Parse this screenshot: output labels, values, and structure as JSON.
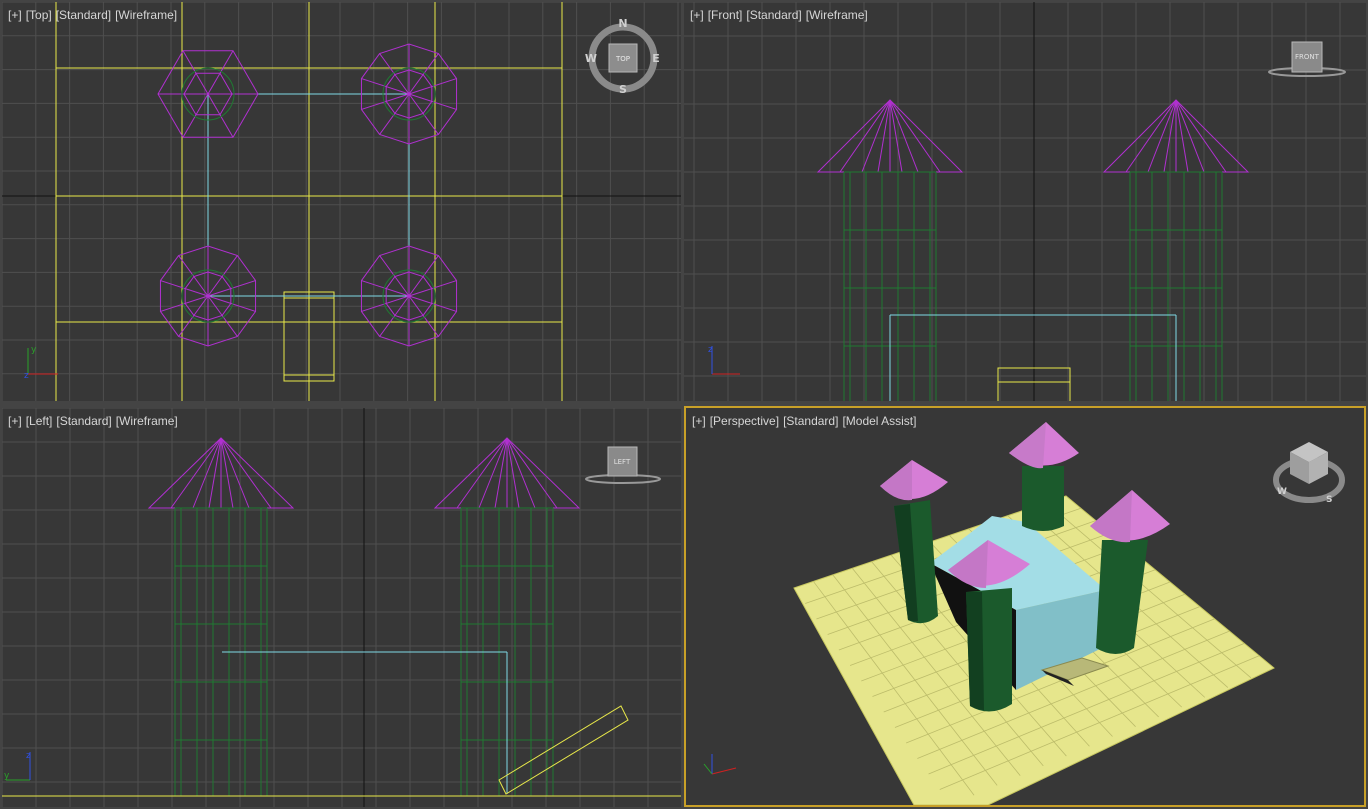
{
  "viewports": {
    "top": {
      "menu": "[+]",
      "view": "[Top]",
      "shading": "[Standard]",
      "display": "[Wireframe]"
    },
    "front": {
      "menu": "[+]",
      "view": "[Front]",
      "shading": "[Standard]",
      "display": "[Wireframe]"
    },
    "left": {
      "menu": "[+]",
      "view": "[Left]",
      "shading": "[Standard]",
      "display": "[Wireframe]"
    },
    "perspective": {
      "menu": "[+]",
      "view": "[Perspective]",
      "shading": "[Standard]",
      "display": "[Model Assist]"
    }
  },
  "viewcube": {
    "top_face": "TOP",
    "front_face": "FRONT",
    "left_face": "LEFT",
    "compass": {
      "n": "N",
      "s": "S",
      "e": "E",
      "w": "W"
    }
  },
  "axes": {
    "x": "x",
    "y": "y",
    "z": "z"
  },
  "colors": {
    "grid": "#4f4f4f",
    "grid_axis": "#121212",
    "plane": "#e6e68c",
    "plane_wire": "#e8e84a",
    "tower": "#1a5a2c",
    "tower_wire": "#1f7a32",
    "roof": "#d67ed6",
    "roof_wire": "#b030d0",
    "building": "#a0dde6",
    "building_wire": "#7fd8e6",
    "active_border": "#c8a028"
  }
}
